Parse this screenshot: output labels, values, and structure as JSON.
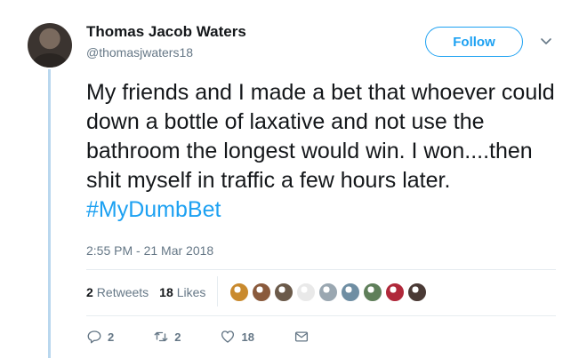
{
  "author": {
    "name": "Thomas Jacob Waters",
    "handle": "@thomasjwaters18"
  },
  "follow_label": "Follow",
  "tweet": {
    "text": "My friends and I made a bet that whoever could down a bottle of laxative and not use the bathroom the longest would win. I won....then shit myself in traffic a few hours later.",
    "hashtag": "#MyDumbBet",
    "timestamp": "2:55 PM - 21 Mar 2018"
  },
  "stats": {
    "retweets_count": "2",
    "retweets_label": "Retweets",
    "likes_count": "18",
    "likes_label": "Likes"
  },
  "liker_avatar_colors": [
    "#c98a2e",
    "#8a5a3c",
    "#6b5a4a",
    "#e9e9e9",
    "#9aa7b1",
    "#6f8ea3",
    "#5f7f5a",
    "#b0283a",
    "#4a3a35"
  ],
  "actions": {
    "reply_count": "2",
    "retweet_count": "2",
    "like_count": "18"
  },
  "colors": {
    "accent": "#1da1f2",
    "muted": "#657786",
    "thread_line": "#b9d7ee"
  }
}
